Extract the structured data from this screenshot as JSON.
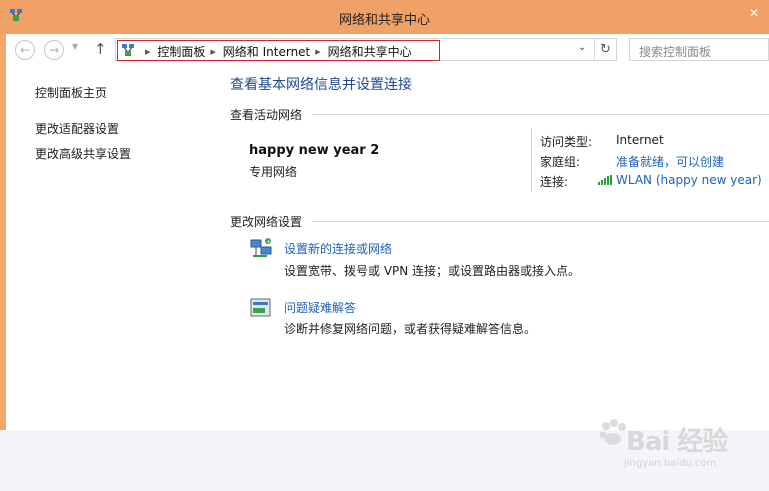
{
  "window": {
    "title": "网络和共享中心"
  },
  "navbar": {
    "back_icon": "back-arrow-icon",
    "forward_icon": "forward-arrow-icon",
    "up_icon": "up-arrow-icon",
    "breadcrumbs": [
      "控制面板",
      "网络和 Internet",
      "网络和共享中心"
    ],
    "search_placeholder": "搜索控制面板"
  },
  "sidebar": {
    "items": [
      {
        "label": "控制面板主页"
      },
      {
        "label": "更改适配器设置"
      },
      {
        "label": "更改高级共享设置"
      }
    ]
  },
  "main": {
    "heading": "查看基本网络信息并设置连接",
    "active_networks_label": "查看活动网络",
    "network": {
      "name": "happy new year  2",
      "type": "专用网络",
      "access_type_label": "访问类型:",
      "access_type_value": "Internet",
      "homegroup_label": "家庭组:",
      "homegroup_value": "准备就绪，可以创建",
      "connection_label": "连接:",
      "connection_value": "WLAN (happy new year)"
    },
    "change_settings_label": "更改网络设置",
    "tasks": [
      {
        "title": "设置新的连接或网络",
        "description": "设置宽带、拨号或 VPN 连接；或设置路由器或接入点。",
        "icon": "new-connection-icon"
      },
      {
        "title": "问题疑难解答",
        "description": "诊断并修复网络问题，或者获得疑难解答信息。",
        "icon": "troubleshoot-icon"
      }
    ]
  },
  "watermark": {
    "brand": "Bai  经验",
    "url": "jingyan.baidu.com"
  },
  "colors": {
    "titlebar": "#f0a166",
    "link": "#1c62b9",
    "heading": "#1f4b8e",
    "highlight_border": "#d2262c"
  }
}
